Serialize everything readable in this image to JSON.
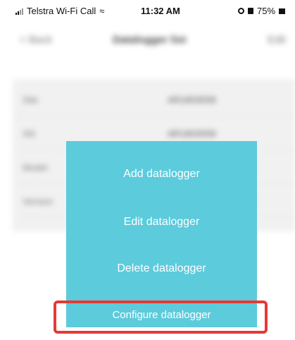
{
  "status_bar": {
    "carrier": "Telstra Wi-Fi Call",
    "time": "11:32 AM",
    "battery": "75%"
  },
  "nav": {
    "back_label": "< Back",
    "title": "Datalogger list",
    "edit_label": "Edit"
  },
  "list": {
    "rows": [
      {
        "label": "Site",
        "value": "AR1803058"
      },
      {
        "label": "SN",
        "value": "AR1803058"
      },
      {
        "label": "Model",
        "value": ""
      },
      {
        "label": "Version",
        "value": ""
      }
    ]
  },
  "menu": {
    "add": "Add datalogger",
    "edit": "Edit datalogger",
    "delete": "Delete datalogger",
    "configure": "Configure datalogger"
  },
  "colors": {
    "menu_background": "#5ccbdc",
    "highlight_border": "#e53935"
  }
}
